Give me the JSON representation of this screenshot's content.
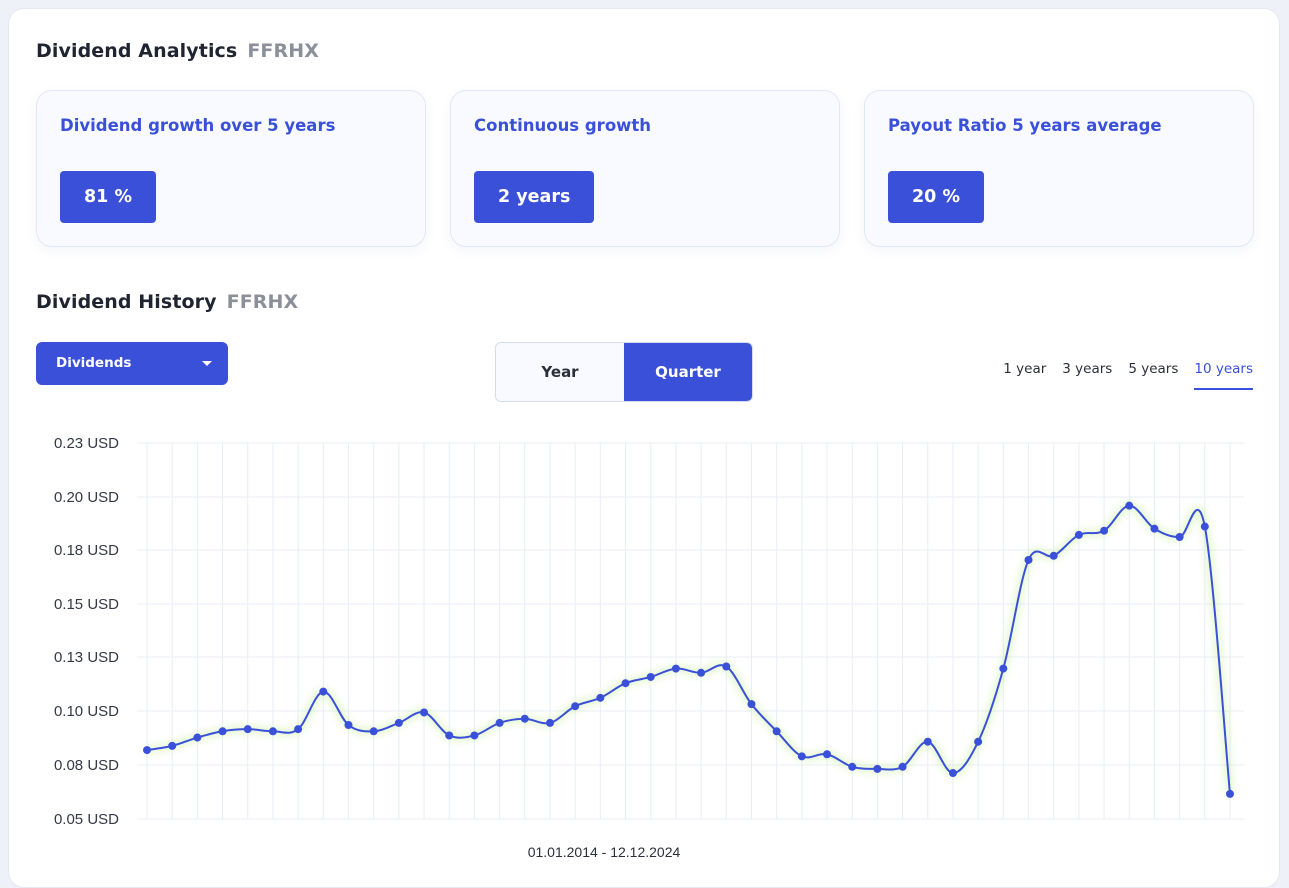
{
  "analytics": {
    "title": "Dividend Analytics",
    "ticker": "FFRHX",
    "cards": [
      {
        "label": "Dividend growth over 5 years",
        "value": "81 %"
      },
      {
        "label": "Continuous growth",
        "value": "2 years"
      },
      {
        "label": "Payout Ratio 5 years average",
        "value": "20 %"
      }
    ]
  },
  "history": {
    "title": "Dividend History",
    "ticker": "FFRHX",
    "dropdown": {
      "selected": "Dividends"
    },
    "toggle": {
      "options": [
        "Year",
        "Quarter"
      ],
      "active": "Quarter"
    },
    "ranges": {
      "options": [
        "1 year",
        "3 years",
        "5 years",
        "10 years"
      ],
      "active": "10 years"
    }
  },
  "colors": {
    "accent": "#3b50d8",
    "grid": "#e8edf6",
    "line": "#3b50d8",
    "glow": "#c8f0a0"
  },
  "chart_data": {
    "type": "line",
    "xlabel": "01.01.2014 - 12.12.2024",
    "ylabel": "",
    "ylim": [
      0.05,
      0.23
    ],
    "yticks": [
      0.23,
      0.2,
      0.18,
      0.15,
      0.13,
      0.1,
      0.08,
      0.05
    ],
    "ytick_labels": [
      "0.23 USD",
      "0.20 USD",
      "0.18 USD",
      "0.15 USD",
      "0.13 USD",
      "0.10 USD",
      "0.08 USD",
      "0.05 USD"
    ],
    "grid": true,
    "series": [
      {
        "values": [
          0.083,
          0.085,
          0.089,
          0.092,
          0.093,
          0.092,
          0.093,
          0.111,
          0.095,
          0.092,
          0.096,
          0.101,
          0.09,
          0.09,
          0.096,
          0.098,
          0.096,
          0.104,
          0.108,
          0.115,
          0.118,
          0.122,
          0.12,
          0.123,
          0.105,
          0.092,
          0.08,
          0.081,
          0.075,
          0.074,
          0.075,
          0.087,
          0.072,
          0.087,
          0.122,
          0.174,
          0.176,
          0.186,
          0.188,
          0.2,
          0.189,
          0.185,
          0.19,
          0.062
        ]
      }
    ]
  }
}
